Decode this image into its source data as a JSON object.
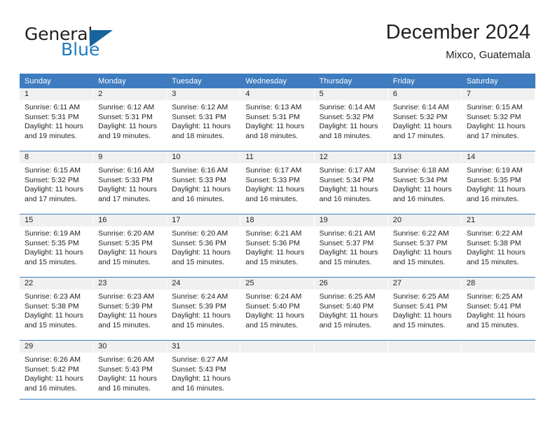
{
  "brand": {
    "name_part1": "General",
    "name_part2": "Blue",
    "triangle_icon": "triangle-icon",
    "accent_color": "#16639e",
    "blue_text_color": "#1f7bc1"
  },
  "header": {
    "title": "December 2024",
    "subtitle": "Mixco, Guatemala"
  },
  "calendar": {
    "header_bg": "#3e7cbf",
    "daynum_bg": "#f0f0f0",
    "weekdays": [
      "Sunday",
      "Monday",
      "Tuesday",
      "Wednesday",
      "Thursday",
      "Friday",
      "Saturday"
    ],
    "labels": {
      "sunrise": "Sunrise:",
      "sunset": "Sunset:",
      "daylight": "Daylight:"
    },
    "weeks": [
      [
        {
          "day": "1",
          "sunrise": "Sunrise: 6:11 AM",
          "sunset": "Sunset: 5:31 PM",
          "daylight_1": "Daylight: 11 hours",
          "daylight_2": "and 19 minutes."
        },
        {
          "day": "2",
          "sunrise": "Sunrise: 6:12 AM",
          "sunset": "Sunset: 5:31 PM",
          "daylight_1": "Daylight: 11 hours",
          "daylight_2": "and 19 minutes."
        },
        {
          "day": "3",
          "sunrise": "Sunrise: 6:12 AM",
          "sunset": "Sunset: 5:31 PM",
          "daylight_1": "Daylight: 11 hours",
          "daylight_2": "and 18 minutes."
        },
        {
          "day": "4",
          "sunrise": "Sunrise: 6:13 AM",
          "sunset": "Sunset: 5:31 PM",
          "daylight_1": "Daylight: 11 hours",
          "daylight_2": "and 18 minutes."
        },
        {
          "day": "5",
          "sunrise": "Sunrise: 6:14 AM",
          "sunset": "Sunset: 5:32 PM",
          "daylight_1": "Daylight: 11 hours",
          "daylight_2": "and 18 minutes."
        },
        {
          "day": "6",
          "sunrise": "Sunrise: 6:14 AM",
          "sunset": "Sunset: 5:32 PM",
          "daylight_1": "Daylight: 11 hours",
          "daylight_2": "and 17 minutes."
        },
        {
          "day": "7",
          "sunrise": "Sunrise: 6:15 AM",
          "sunset": "Sunset: 5:32 PM",
          "daylight_1": "Daylight: 11 hours",
          "daylight_2": "and 17 minutes."
        }
      ],
      [
        {
          "day": "8",
          "sunrise": "Sunrise: 6:15 AM",
          "sunset": "Sunset: 5:32 PM",
          "daylight_1": "Daylight: 11 hours",
          "daylight_2": "and 17 minutes."
        },
        {
          "day": "9",
          "sunrise": "Sunrise: 6:16 AM",
          "sunset": "Sunset: 5:33 PM",
          "daylight_1": "Daylight: 11 hours",
          "daylight_2": "and 17 minutes."
        },
        {
          "day": "10",
          "sunrise": "Sunrise: 6:16 AM",
          "sunset": "Sunset: 5:33 PM",
          "daylight_1": "Daylight: 11 hours",
          "daylight_2": "and 16 minutes."
        },
        {
          "day": "11",
          "sunrise": "Sunrise: 6:17 AM",
          "sunset": "Sunset: 5:33 PM",
          "daylight_1": "Daylight: 11 hours",
          "daylight_2": "and 16 minutes."
        },
        {
          "day": "12",
          "sunrise": "Sunrise: 6:17 AM",
          "sunset": "Sunset: 5:34 PM",
          "daylight_1": "Daylight: 11 hours",
          "daylight_2": "and 16 minutes."
        },
        {
          "day": "13",
          "sunrise": "Sunrise: 6:18 AM",
          "sunset": "Sunset: 5:34 PM",
          "daylight_1": "Daylight: 11 hours",
          "daylight_2": "and 16 minutes."
        },
        {
          "day": "14",
          "sunrise": "Sunrise: 6:19 AM",
          "sunset": "Sunset: 5:35 PM",
          "daylight_1": "Daylight: 11 hours",
          "daylight_2": "and 16 minutes."
        }
      ],
      [
        {
          "day": "15",
          "sunrise": "Sunrise: 6:19 AM",
          "sunset": "Sunset: 5:35 PM",
          "daylight_1": "Daylight: 11 hours",
          "daylight_2": "and 15 minutes."
        },
        {
          "day": "16",
          "sunrise": "Sunrise: 6:20 AM",
          "sunset": "Sunset: 5:35 PM",
          "daylight_1": "Daylight: 11 hours",
          "daylight_2": "and 15 minutes."
        },
        {
          "day": "17",
          "sunrise": "Sunrise: 6:20 AM",
          "sunset": "Sunset: 5:36 PM",
          "daylight_1": "Daylight: 11 hours",
          "daylight_2": "and 15 minutes."
        },
        {
          "day": "18",
          "sunrise": "Sunrise: 6:21 AM",
          "sunset": "Sunset: 5:36 PM",
          "daylight_1": "Daylight: 11 hours",
          "daylight_2": "and 15 minutes."
        },
        {
          "day": "19",
          "sunrise": "Sunrise: 6:21 AM",
          "sunset": "Sunset: 5:37 PM",
          "daylight_1": "Daylight: 11 hours",
          "daylight_2": "and 15 minutes."
        },
        {
          "day": "20",
          "sunrise": "Sunrise: 6:22 AM",
          "sunset": "Sunset: 5:37 PM",
          "daylight_1": "Daylight: 11 hours",
          "daylight_2": "and 15 minutes."
        },
        {
          "day": "21",
          "sunrise": "Sunrise: 6:22 AM",
          "sunset": "Sunset: 5:38 PM",
          "daylight_1": "Daylight: 11 hours",
          "daylight_2": "and 15 minutes."
        }
      ],
      [
        {
          "day": "22",
          "sunrise": "Sunrise: 6:23 AM",
          "sunset": "Sunset: 5:38 PM",
          "daylight_1": "Daylight: 11 hours",
          "daylight_2": "and 15 minutes."
        },
        {
          "day": "23",
          "sunrise": "Sunrise: 6:23 AM",
          "sunset": "Sunset: 5:39 PM",
          "daylight_1": "Daylight: 11 hours",
          "daylight_2": "and 15 minutes."
        },
        {
          "day": "24",
          "sunrise": "Sunrise: 6:24 AM",
          "sunset": "Sunset: 5:39 PM",
          "daylight_1": "Daylight: 11 hours",
          "daylight_2": "and 15 minutes."
        },
        {
          "day": "25",
          "sunrise": "Sunrise: 6:24 AM",
          "sunset": "Sunset: 5:40 PM",
          "daylight_1": "Daylight: 11 hours",
          "daylight_2": "and 15 minutes."
        },
        {
          "day": "26",
          "sunrise": "Sunrise: 6:25 AM",
          "sunset": "Sunset: 5:40 PM",
          "daylight_1": "Daylight: 11 hours",
          "daylight_2": "and 15 minutes."
        },
        {
          "day": "27",
          "sunrise": "Sunrise: 6:25 AM",
          "sunset": "Sunset: 5:41 PM",
          "daylight_1": "Daylight: 11 hours",
          "daylight_2": "and 15 minutes."
        },
        {
          "day": "28",
          "sunrise": "Sunrise: 6:25 AM",
          "sunset": "Sunset: 5:41 PM",
          "daylight_1": "Daylight: 11 hours",
          "daylight_2": "and 15 minutes."
        }
      ],
      [
        {
          "day": "29",
          "sunrise": "Sunrise: 6:26 AM",
          "sunset": "Sunset: 5:42 PM",
          "daylight_1": "Daylight: 11 hours",
          "daylight_2": "and 16 minutes."
        },
        {
          "day": "30",
          "sunrise": "Sunrise: 6:26 AM",
          "sunset": "Sunset: 5:43 PM",
          "daylight_1": "Daylight: 11 hours",
          "daylight_2": "and 16 minutes."
        },
        {
          "day": "31",
          "sunrise": "Sunrise: 6:27 AM",
          "sunset": "Sunset: 5:43 PM",
          "daylight_1": "Daylight: 11 hours",
          "daylight_2": "and 16 minutes."
        },
        {
          "day": "",
          "sunrise": "",
          "sunset": "",
          "daylight_1": "",
          "daylight_2": ""
        },
        {
          "day": "",
          "sunrise": "",
          "sunset": "",
          "daylight_1": "",
          "daylight_2": ""
        },
        {
          "day": "",
          "sunrise": "",
          "sunset": "",
          "daylight_1": "",
          "daylight_2": ""
        },
        {
          "day": "",
          "sunrise": "",
          "sunset": "",
          "daylight_1": "",
          "daylight_2": ""
        }
      ]
    ]
  }
}
